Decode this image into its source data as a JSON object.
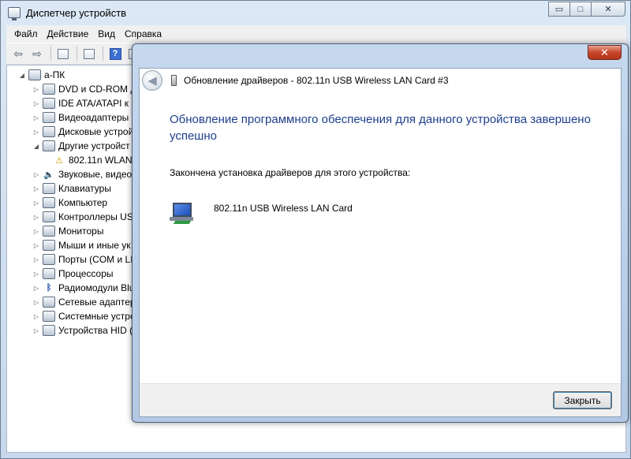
{
  "main_window": {
    "title": "Диспетчер устройств",
    "controls": {
      "minimize": "▭",
      "maximize": "□",
      "close": "✕"
    },
    "menu": [
      "Файл",
      "Действие",
      "Вид",
      "Справка"
    ],
    "toolbar_icons": [
      "back-arrow-icon",
      "forward-arrow-icon",
      "console-tree-icon",
      "properties-icon",
      "help-icon",
      "scan-icon"
    ],
    "tree": {
      "root": "а-ПК",
      "items": [
        {
          "label": "DVD и CD-ROM д",
          "icon": "dvd-icon",
          "expanded": false
        },
        {
          "label": "IDE ATA/ATAPI к",
          "icon": "ide-controller-icon",
          "expanded": false
        },
        {
          "label": "Видеоадаптеры",
          "icon": "display-adapter-icon",
          "expanded": false
        },
        {
          "label": "Дисковые устрой",
          "icon": "disk-icon",
          "expanded": false
        },
        {
          "label": "Другие устройст",
          "icon": "other-devices-icon",
          "expanded": true
        },
        {
          "label": "802.11n WLAN",
          "icon": "warning-device-icon",
          "child": true
        },
        {
          "label": "Звуковые, видео",
          "icon": "sound-icon",
          "expanded": false
        },
        {
          "label": "Клавиатуры",
          "icon": "keyboard-icon",
          "expanded": false
        },
        {
          "label": "Компьютер",
          "icon": "computer-icon",
          "expanded": false
        },
        {
          "label": "Контроллеры US",
          "icon": "usb-icon",
          "expanded": false
        },
        {
          "label": "Мониторы",
          "icon": "monitor-icon",
          "expanded": false
        },
        {
          "label": "Мыши и иные ук",
          "icon": "mouse-icon",
          "expanded": false
        },
        {
          "label": "Порты (COM и LI",
          "icon": "port-icon",
          "expanded": false
        },
        {
          "label": "Процессоры",
          "icon": "processor-icon",
          "expanded": false
        },
        {
          "label": "Радиомодули Blu",
          "icon": "bluetooth-icon",
          "expanded": false
        },
        {
          "label": "Сетевые адаптер",
          "icon": "network-adapter-icon",
          "expanded": false
        },
        {
          "label": "Системные устро",
          "icon": "system-devices-icon",
          "expanded": false
        },
        {
          "label": "Устройства HID (",
          "icon": "hid-icon",
          "expanded": false
        }
      ]
    }
  },
  "dialog": {
    "close_symbol": "✕",
    "title": "Обновление драйверов - 802.11n USB Wireless LAN Card #3",
    "heading": "Обновление программного обеспечения для данного устройства завершено успешно",
    "message": "Закончена установка драйверов для этого устройства:",
    "device_name": "802.11n USB Wireless LAN Card",
    "button_close": "Закрыть"
  }
}
